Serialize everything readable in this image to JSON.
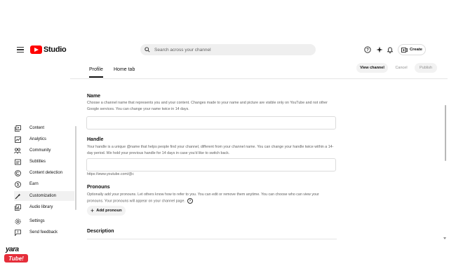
{
  "app": {
    "logo_text": "Studio"
  },
  "search": {
    "placeholder": "Search across your channel"
  },
  "header": {
    "create_label": "Create"
  },
  "tabs": [
    {
      "label": "Profile",
      "active": true
    },
    {
      "label": "Home tab",
      "active": false
    }
  ],
  "actions": {
    "view_channel": "View channel",
    "cancel": "Cancel",
    "publish": "Publish"
  },
  "sidebar": {
    "items": [
      {
        "label": "Content",
        "icon": "content-icon"
      },
      {
        "label": "Analytics",
        "icon": "analytics-icon"
      },
      {
        "label": "Community",
        "icon": "community-icon"
      },
      {
        "label": "Subtitles",
        "icon": "subtitles-icon"
      },
      {
        "label": "Content detection",
        "icon": "copyright-icon"
      },
      {
        "label": "Earn",
        "icon": "dollar-icon"
      },
      {
        "label": "Customization",
        "icon": "magic-wand-icon",
        "active": true
      },
      {
        "label": "Audio library",
        "icon": "audio-library-icon"
      },
      {
        "label": "Settings",
        "icon": "gear-icon"
      },
      {
        "label": "Send feedback",
        "icon": "feedback-icon"
      }
    ]
  },
  "form": {
    "name": {
      "title": "Name",
      "description": "Choose a channel name that represents you and your content. Changes made to your name and picture are visible only on YouTube and not other Google services. You can change your name twice in 14 days."
    },
    "handle": {
      "title": "Handle",
      "description": "Your handle is a unique @name that helps people find your channel, different from your channel name. You can change your handle twice within a 14-day period. We hold your previous handle for 14 days in case you'd like to switch back.",
      "url_prefix": "https://www.youtube.com/@c"
    },
    "pronouns": {
      "title": "Pronouns",
      "description": "Optionally add your pronouns. Let others know how to refer to you. You can edit or remove them anytime. You can choose who can view your pronouns. Your pronouns will appear on your channel page.",
      "add_label": "Add pronoun"
    },
    "description": {
      "title": "Description"
    }
  },
  "watermark": {
    "line1": "yara",
    "line2": "Tube!"
  }
}
